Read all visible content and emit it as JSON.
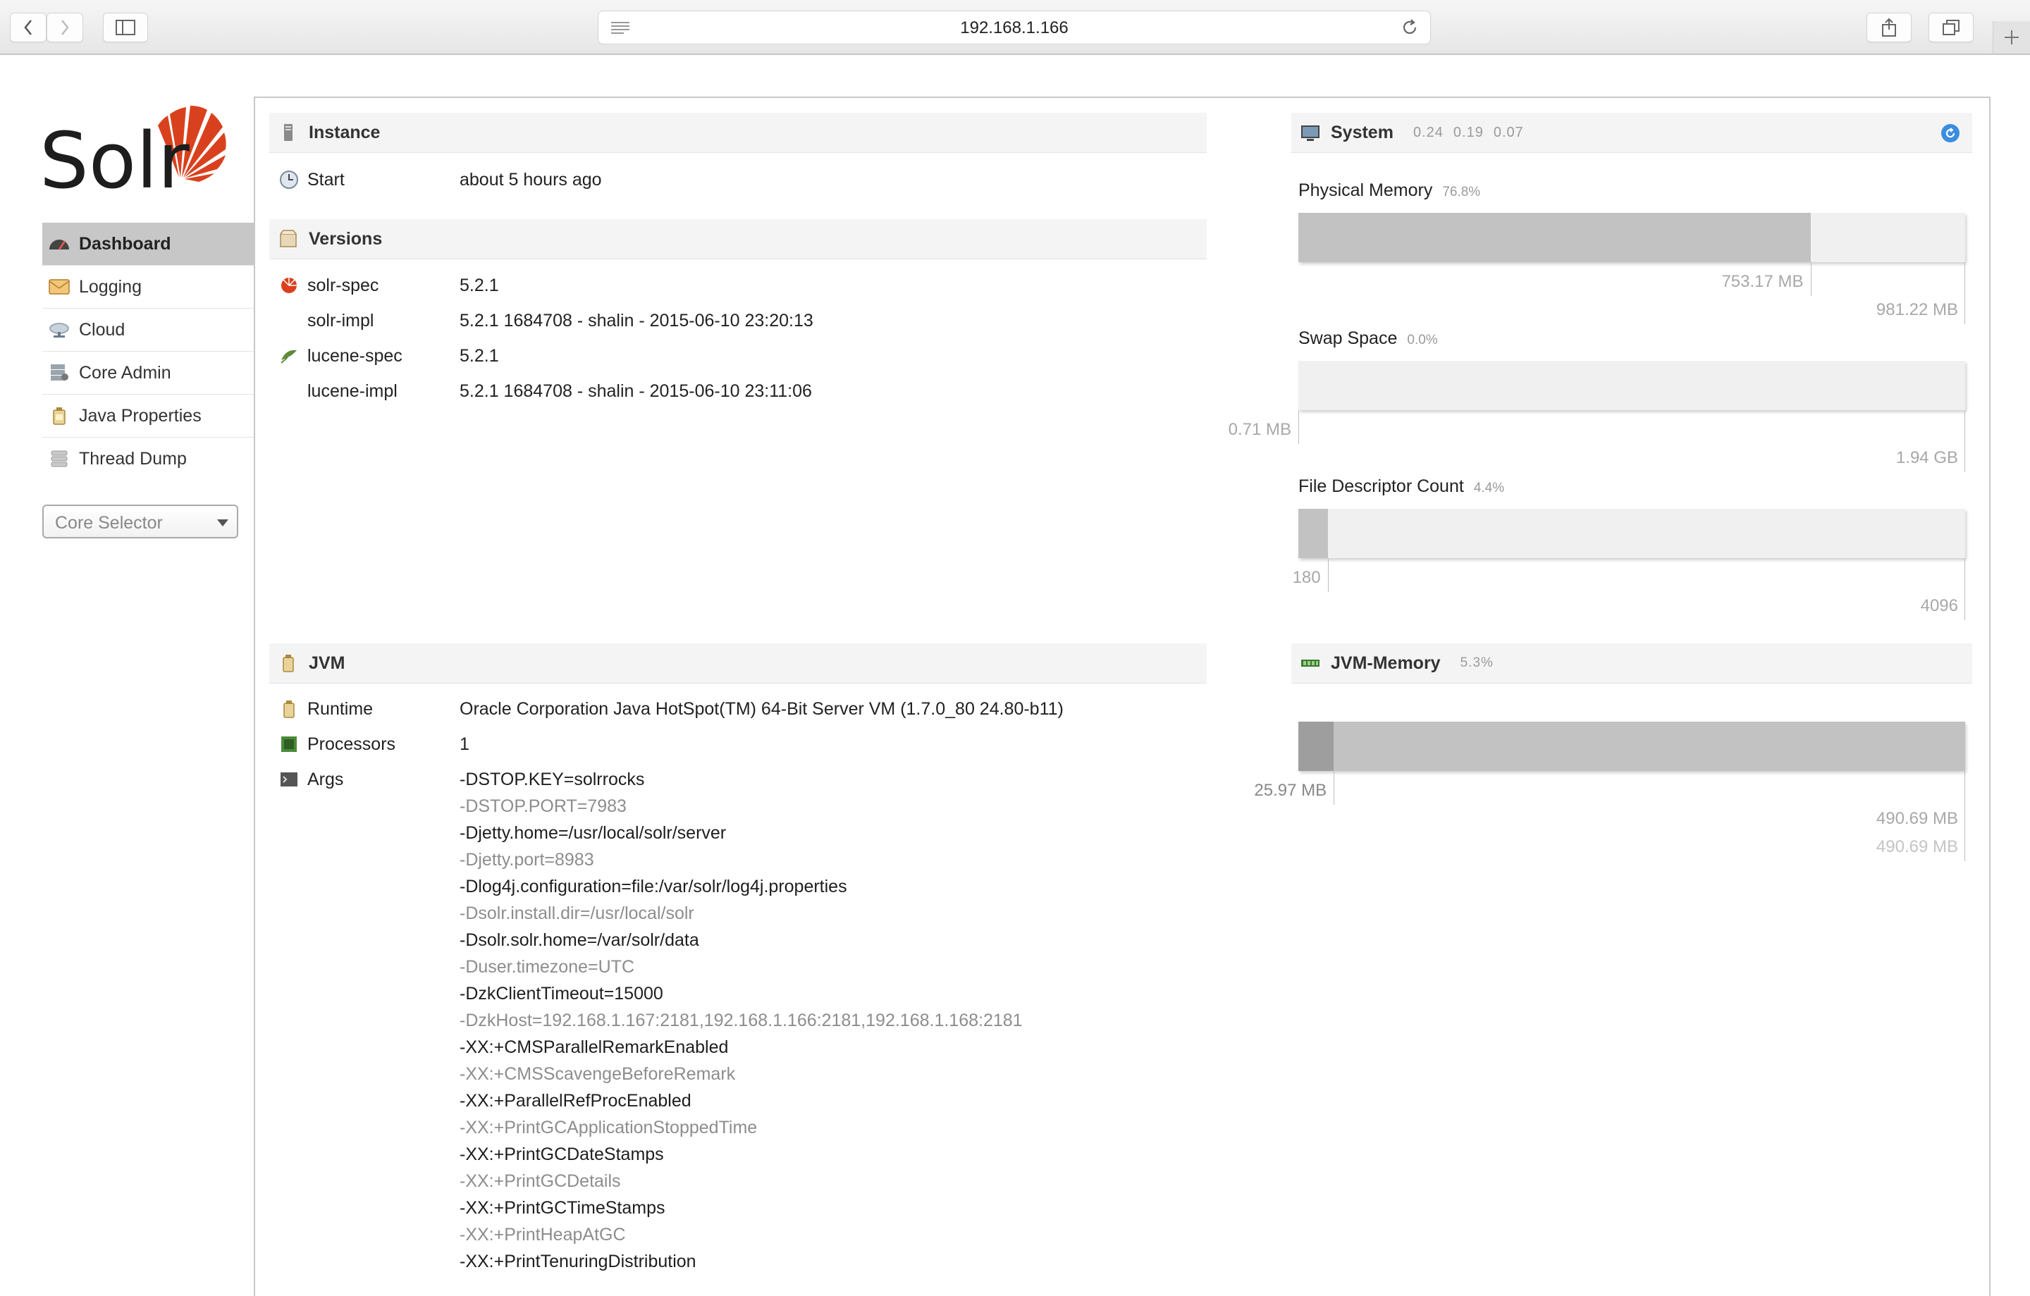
{
  "browser": {
    "url": "192.168.1.166"
  },
  "sidebar": {
    "logo_text": "Solr",
    "items": [
      {
        "label": "Dashboard",
        "icon": "dashboard-icon",
        "active": true
      },
      {
        "label": "Logging",
        "icon": "logging-icon",
        "active": false
      },
      {
        "label": "Cloud",
        "icon": "cloud-icon",
        "active": false
      },
      {
        "label": "Core Admin",
        "icon": "core-admin-icon",
        "active": false
      },
      {
        "label": "Java Properties",
        "icon": "java-properties-icon",
        "active": false
      },
      {
        "label": "Thread Dump",
        "icon": "thread-dump-icon",
        "active": false
      }
    ],
    "core_selector": "Core Selector"
  },
  "instance": {
    "title": "Instance",
    "start_label": "Start",
    "start_value": "about 5 hours ago"
  },
  "versions": {
    "title": "Versions",
    "rows": [
      {
        "label": "solr-spec",
        "value": "5.2.1"
      },
      {
        "label": "solr-impl",
        "value": "5.2.1 1684708 - shalin - 2015-06-10 23:20:13"
      },
      {
        "label": "lucene-spec",
        "value": "5.2.1"
      },
      {
        "label": "lucene-impl",
        "value": "5.2.1 1684708 - shalin - 2015-06-10 23:11:06"
      }
    ]
  },
  "jvm": {
    "title": "JVM",
    "runtime_label": "Runtime",
    "runtime_value": "Oracle Corporation Java HotSpot(TM) 64-Bit Server VM (1.7.0_80 24.80-b11)",
    "processors_label": "Processors",
    "processors_value": "1",
    "args_label": "Args",
    "args": [
      "-DSTOP.KEY=solrrocks",
      "-DSTOP.PORT=7983",
      "-Djetty.home=/usr/local/solr/server",
      "-Djetty.port=8983",
      "-Dlog4j.configuration=file:/var/solr/log4j.properties",
      "-Dsolr.install.dir=/usr/local/solr",
      "-Dsolr.solr.home=/var/solr/data",
      "-Duser.timezone=UTC",
      "-DzkClientTimeout=15000",
      "-DzkHost=192.168.1.167:2181,192.168.1.166:2181,192.168.1.168:2181",
      "-XX:+CMSParallelRemarkEnabled",
      "-XX:+CMSScavengeBeforeRemark",
      "-XX:+ParallelRefProcEnabled",
      "-XX:+PrintGCApplicationStoppedTime",
      "-XX:+PrintGCDateStamps",
      "-XX:+PrintGCDetails",
      "-XX:+PrintGCTimeStamps",
      "-XX:+PrintHeapAtGC",
      "-XX:+PrintTenuringDistribution"
    ]
  },
  "system": {
    "title": "System",
    "load": [
      "0.24",
      "0.19",
      "0.07"
    ],
    "physical_memory": {
      "label": "Physical Memory",
      "percent": "76.8%",
      "used": "753.17 MB",
      "total": "981.22 MB",
      "fraction": 0.768
    },
    "swap_space": {
      "label": "Swap Space",
      "percent": "0.0%",
      "used": "0.71 MB",
      "total": "1.94 GB",
      "fraction": 0.0
    },
    "file_descriptors": {
      "label": "File Descriptor Count",
      "percent": "4.4%",
      "used": "180",
      "total": "4096",
      "fraction": 0.044
    }
  },
  "jvm_memory": {
    "title": "JVM-Memory",
    "percent": "5.3%",
    "used": "25.97 MB",
    "committed": "490.69 MB",
    "max": "490.69 MB",
    "used_fraction": 0.053,
    "committed_fraction": 1.0
  },
  "colors": {
    "active_nav": "#c7c7c7",
    "bar_fill": "#c2c2c2",
    "bar_bg": "#f0f0f0",
    "logo_red": "#d9411e"
  }
}
